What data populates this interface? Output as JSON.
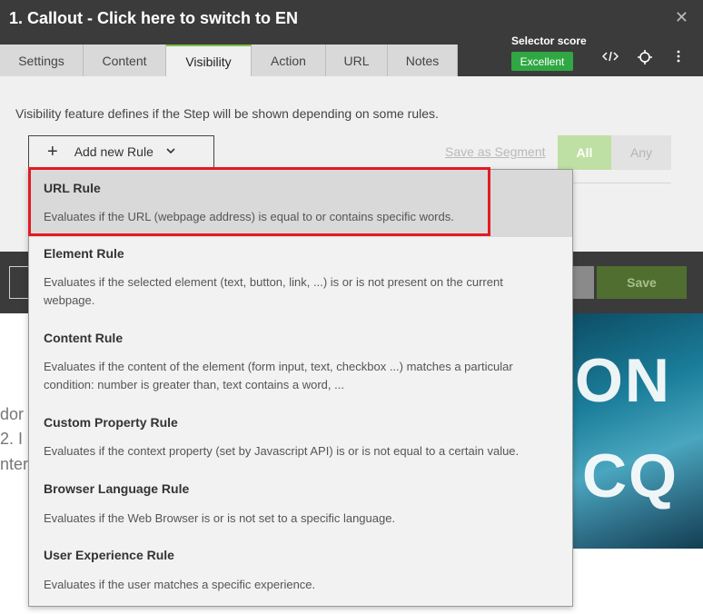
{
  "panel": {
    "title": "1. Callout - Click here to switch to EN",
    "tabs": [
      {
        "label": "Settings"
      },
      {
        "label": "Content"
      },
      {
        "label": "Visibility"
      },
      {
        "label": "Action"
      },
      {
        "label": "URL"
      },
      {
        "label": "Notes"
      }
    ],
    "active_tab": "Visibility",
    "selector_score_label": "Selector score",
    "selector_score_value": "Excellent",
    "close_icon": "close-icon",
    "toolbar_icons": [
      "code-icon",
      "crosshair-icon",
      "more-vertical-icon"
    ]
  },
  "visibility": {
    "description": "Visibility feature defines if the Step will be shown depending on some rules.",
    "add_rule_label": "Add new Rule",
    "save_segment_label": "Save as Segment",
    "match_all_label": "All",
    "match_any_label": "Any"
  },
  "footer": {
    "save_label": "Save"
  },
  "dropdown": {
    "items": [
      {
        "title": "URL Rule",
        "description": "Evaluates if the URL (webpage address) is equal to or contains specific words."
      },
      {
        "title": "Element Rule",
        "description": "Evaluates if the selected element (text, button, link, ...) is or is not present on the current webpage."
      },
      {
        "title": "Content Rule",
        "description": "Evaluates if the content of the element (form input, text, checkbox ...) matches a particular condition: number is greater than, text contains a word, ..."
      },
      {
        "title": "Custom Property Rule",
        "description": "Evaluates if the context property (set by Javascript API) is or is not equal to a certain value."
      },
      {
        "title": "Browser Language Rule",
        "description": "Evaluates if the Web Browser is or is not set to a specific language."
      },
      {
        "title": "User Experience Rule",
        "description": "Evaluates if the user matches a specific experience."
      }
    ]
  },
  "background": {
    "text_fragments": [
      "dor",
      "2. I",
      "nter"
    ],
    "image_text": [
      "ON",
      "CQ"
    ]
  },
  "colors": {
    "titlebar": "#3b3b3b",
    "accent_green": "#2fa843",
    "highlight_red": "#e21b23"
  }
}
